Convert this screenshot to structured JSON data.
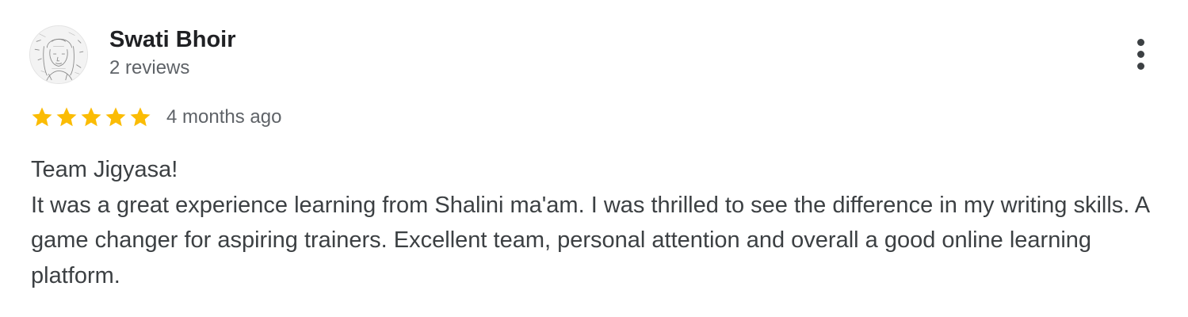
{
  "review": {
    "reviewer": {
      "name": "Swati Bhoir",
      "review_count": "2 reviews",
      "avatar_icon": "sketch-portrait-avatar"
    },
    "rating": {
      "stars": 5,
      "max_stars": 5,
      "star_color": "#fbbc04",
      "time": "4 months ago"
    },
    "more_icon": "vertical-dots-icon",
    "text": {
      "greeting": "Team Jigyasa!",
      "body": "It was a great experience learning from Shalini ma'am. I was thrilled to see the difference in my writing skills. A game changer for aspiring trainers. Excellent team, personal attention and overall a good online learning platform."
    }
  },
  "colors": {
    "name": "#202124",
    "meta": "#5f6368",
    "body": "#3c4043"
  }
}
